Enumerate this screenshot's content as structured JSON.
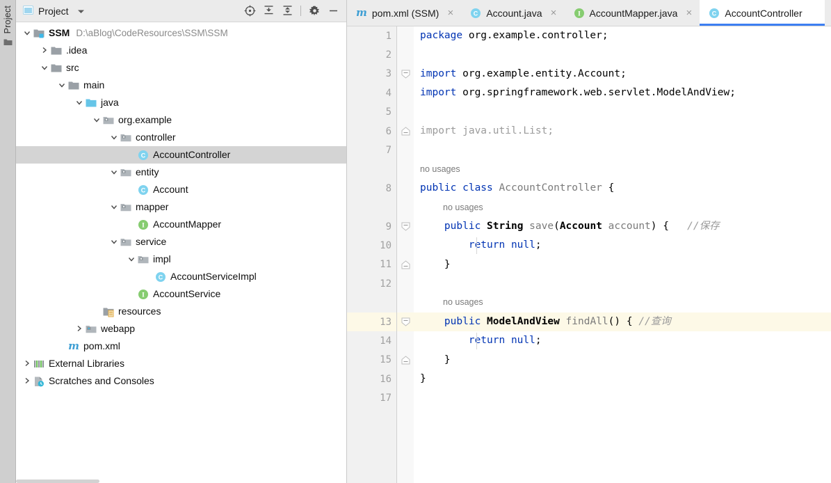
{
  "window": {
    "stripe": {
      "label": "Project",
      "icon": "folder-icon"
    }
  },
  "project_panel": {
    "title": "Project",
    "title_icon": "project-window-icon",
    "dropdown_icon": "chevron-down-icon",
    "toolbar": [
      {
        "name": "select-opened-file-icon",
        "label": "Select Opened File"
      },
      {
        "name": "expand-all-icon",
        "label": "Expand All"
      },
      {
        "name": "collapse-all-icon",
        "label": "Collapse All"
      },
      {
        "name": "settings-gear-icon",
        "label": "Options"
      },
      {
        "name": "hide-icon",
        "label": "Hide"
      }
    ],
    "tree": [
      {
        "label": "SSM",
        "sub": "D:\\aBlog\\CodeResources\\SSM\\SSM",
        "indent": 0,
        "arrow": "expanded",
        "icon": "module-folder-icon",
        "bold": true,
        "selected": false
      },
      {
        "label": ".idea",
        "sub": "",
        "indent": 1,
        "arrow": "collapsed",
        "icon": "folder-gray-icon",
        "bold": false,
        "selected": false
      },
      {
        "label": "src",
        "sub": "",
        "indent": 1,
        "arrow": "expanded",
        "icon": "folder-gray-icon",
        "bold": false,
        "selected": false
      },
      {
        "label": "main",
        "sub": "",
        "indent": 2,
        "arrow": "expanded",
        "icon": "folder-gray-icon",
        "bold": false,
        "selected": false
      },
      {
        "label": "java",
        "sub": "",
        "indent": 3,
        "arrow": "expanded",
        "icon": "source-root-icon",
        "bold": false,
        "selected": false
      },
      {
        "label": "org.example",
        "sub": "",
        "indent": 4,
        "arrow": "expanded",
        "icon": "package-icon",
        "bold": false,
        "selected": false
      },
      {
        "label": "controller",
        "sub": "",
        "indent": 5,
        "arrow": "expanded",
        "icon": "package-icon",
        "bold": false,
        "selected": false
      },
      {
        "label": "AccountController",
        "sub": "",
        "indent": 6,
        "arrow": "none",
        "icon": "java-class-icon",
        "bold": false,
        "selected": true
      },
      {
        "label": "entity",
        "sub": "",
        "indent": 5,
        "arrow": "expanded",
        "icon": "package-icon",
        "bold": false,
        "selected": false
      },
      {
        "label": "Account",
        "sub": "",
        "indent": 6,
        "arrow": "none",
        "icon": "java-class-icon",
        "bold": false,
        "selected": false
      },
      {
        "label": "mapper",
        "sub": "",
        "indent": 5,
        "arrow": "expanded",
        "icon": "package-icon",
        "bold": false,
        "selected": false
      },
      {
        "label": "AccountMapper",
        "sub": "",
        "indent": 6,
        "arrow": "none",
        "icon": "java-interface-icon",
        "bold": false,
        "selected": false
      },
      {
        "label": "service",
        "sub": "",
        "indent": 5,
        "arrow": "expanded",
        "icon": "package-icon",
        "bold": false,
        "selected": false
      },
      {
        "label": "impl",
        "sub": "",
        "indent": 6,
        "arrow": "expanded",
        "icon": "package-icon",
        "bold": false,
        "selected": false
      },
      {
        "label": "AccountServiceImpl",
        "sub": "",
        "indent": 7,
        "arrow": "none",
        "icon": "java-class-icon",
        "bold": false,
        "selected": false
      },
      {
        "label": "AccountService",
        "sub": "",
        "indent": 6,
        "arrow": "none",
        "icon": "java-interface-icon",
        "bold": false,
        "selected": false
      },
      {
        "label": "resources",
        "sub": "",
        "indent": 4,
        "arrow": "none",
        "icon": "resources-root-icon",
        "bold": false,
        "selected": false
      },
      {
        "label": "webapp",
        "sub": "",
        "indent": 3,
        "arrow": "collapsed",
        "icon": "webapp-root-icon",
        "bold": false,
        "selected": false
      },
      {
        "label": "pom.xml",
        "sub": "",
        "indent": 2,
        "arrow": "none",
        "icon": "maven-icon",
        "bold": false,
        "selected": false
      },
      {
        "label": "External Libraries",
        "sub": "",
        "indent": 0,
        "arrow": "collapsed",
        "icon": "external-libraries-icon",
        "bold": false,
        "selected": false
      },
      {
        "label": "Scratches and Consoles",
        "sub": "",
        "indent": 0,
        "arrow": "collapsed",
        "icon": "scratches-icon",
        "bold": false,
        "selected": false
      }
    ]
  },
  "editor": {
    "tabs": [
      {
        "label": "pom.xml (SSM)",
        "icon": "maven-icon",
        "active": false,
        "closable": true
      },
      {
        "label": "Account.java",
        "icon": "java-class-icon",
        "active": false,
        "closable": true
      },
      {
        "label": "AccountMapper.java",
        "icon": "java-interface-icon",
        "active": false,
        "closable": true
      },
      {
        "label": "AccountController",
        "icon": "java-class-icon",
        "active": true,
        "closable": false
      }
    ],
    "active_tab_underline_color": "#3d7ff2",
    "caret_line": 13,
    "caret_line_color": "#fdf9e7",
    "gutter_icon": {
      "name": "intention-bulb-icon",
      "line": 13
    },
    "line_numbers": [
      1,
      2,
      3,
      4,
      5,
      6,
      7,
      8,
      9,
      10,
      11,
      12,
      13,
      14,
      15,
      16,
      17
    ],
    "code_rows": [
      {
        "kind": "code",
        "num": 1,
        "tokens": [
          {
            "t": "kw",
            "v": "package"
          },
          {
            "t": "pln",
            "v": " org.example.controller;"
          }
        ]
      },
      {
        "kind": "code",
        "num": 2,
        "tokens": []
      },
      {
        "kind": "code",
        "num": 3,
        "fold": "start",
        "tokens": [
          {
            "t": "kw",
            "v": "import"
          },
          {
            "t": "pln",
            "v": " org.example.entity.Account;"
          }
        ]
      },
      {
        "kind": "code",
        "num": 4,
        "tokens": [
          {
            "t": "kw",
            "v": "import"
          },
          {
            "t": "pln",
            "v": " org.springframework.web.servlet.ModelAndView;"
          }
        ]
      },
      {
        "kind": "code",
        "num": 5,
        "tokens": []
      },
      {
        "kind": "code",
        "num": 6,
        "fold": "end",
        "tokens": [
          {
            "t": "gray",
            "v": "import java.util.List;"
          }
        ]
      },
      {
        "kind": "code",
        "num": 7,
        "tokens": []
      },
      {
        "kind": "inlay",
        "indent": 0,
        "text": "no usages"
      },
      {
        "kind": "code",
        "num": 8,
        "tokens": [
          {
            "t": "kw",
            "v": "public class"
          },
          {
            "t": "pln",
            "v": " "
          },
          {
            "t": "mth",
            "v": "AccountController"
          },
          {
            "t": "pln",
            "v": " {"
          }
        ]
      },
      {
        "kind": "inlay",
        "indent": 1,
        "text": "no usages"
      },
      {
        "kind": "code",
        "num": 9,
        "fold": "start",
        "tokens": [
          {
            "t": "pln",
            "v": "    "
          },
          {
            "t": "kw",
            "v": "public"
          },
          {
            "t": "pln",
            "v": " "
          },
          {
            "t": "ty",
            "v": "String"
          },
          {
            "t": "pln",
            "v": " "
          },
          {
            "t": "mth",
            "v": "save"
          },
          {
            "t": "pln",
            "v": "("
          },
          {
            "t": "ty",
            "v": "Account"
          },
          {
            "t": "pln",
            "v": " "
          },
          {
            "t": "mth",
            "v": "account"
          },
          {
            "t": "pln",
            "v": ") {"
          },
          {
            "t": "cmt",
            "v": "   //保存"
          }
        ]
      },
      {
        "kind": "code",
        "num": 10,
        "tokens": [
          {
            "t": "pln",
            "v": "        "
          },
          {
            "t": "kw",
            "v": "return null"
          },
          {
            "t": "pln",
            "v": ";"
          }
        ]
      },
      {
        "kind": "code",
        "num": 11,
        "fold": "end",
        "tokens": [
          {
            "t": "pln",
            "v": "    }"
          }
        ]
      },
      {
        "kind": "code",
        "num": 12,
        "tokens": []
      },
      {
        "kind": "inlay",
        "indent": 1,
        "text": "no usages"
      },
      {
        "kind": "code",
        "num": 13,
        "hl": true,
        "bulb": true,
        "fold": "start",
        "tokens": [
          {
            "t": "pln",
            "v": "    "
          },
          {
            "t": "kw",
            "v": "public"
          },
          {
            "t": "pln",
            "v": " "
          },
          {
            "t": "ty",
            "v": "ModelAndView"
          },
          {
            "t": "pln",
            "v": " "
          },
          {
            "t": "mth",
            "v": "findAll"
          },
          {
            "t": "pln",
            "v": "() { "
          },
          {
            "t": "cmt",
            "v": "//查询"
          }
        ]
      },
      {
        "kind": "code",
        "num": 14,
        "tokens": [
          {
            "t": "pln",
            "v": "        "
          },
          {
            "t": "kw",
            "v": "return null"
          },
          {
            "t": "pln",
            "v": ";"
          }
        ]
      },
      {
        "kind": "code",
        "num": 15,
        "fold": "end",
        "tokens": [
          {
            "t": "pln",
            "v": "    }"
          }
        ]
      },
      {
        "kind": "code",
        "num": 16,
        "tokens": [
          {
            "t": "pln",
            "v": "}"
          }
        ]
      },
      {
        "kind": "code",
        "num": 17,
        "tokens": []
      }
    ]
  },
  "colors": {
    "keyword": "#0033b3",
    "comment": "#9a9a9a",
    "method": "#7a7a7a",
    "unused_import": "#9b9b9b",
    "selection": "#d4d4d4",
    "caret_line": "#fdf9e7",
    "tab_accent": "#3d7ff2",
    "class_icon": "#4fb3d9",
    "interface_icon": "#79c267",
    "maven_icon": "#4a9fd4"
  }
}
